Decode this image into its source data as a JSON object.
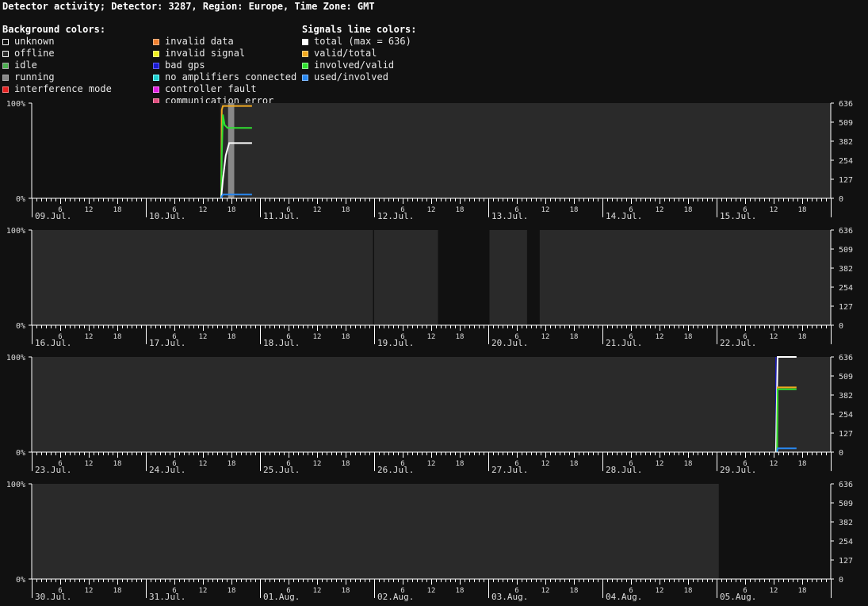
{
  "title": "Detector activity; Detector: 3287, Region: Europe, Time Zone: GMT",
  "legend": {
    "background": {
      "header": "Background colors:",
      "items": [
        {
          "label": "unknown",
          "color": "#111111",
          "border": "#ffffff"
        },
        {
          "label": "offline",
          "color": "#2a2a2a",
          "border": "#ffffff"
        },
        {
          "label": "idle",
          "color": "#4caf50",
          "border": "#aaaaaa"
        },
        {
          "label": "running",
          "color": "#888888",
          "border": "#aaaaaa"
        },
        {
          "label": "interference mode",
          "color": "#e52020",
          "border": "#ff8080"
        }
      ]
    },
    "errors": {
      "items": [
        {
          "label": "invalid data",
          "color": "#f08030",
          "border": "#ffb080"
        },
        {
          "label": "invalid signal",
          "color": "#f0f020",
          "border": "#ffff80"
        },
        {
          "label": "bad gps",
          "color": "#1a1ad0",
          "border": "#6060ff"
        },
        {
          "label": "no amplifiers connected",
          "color": "#20d0d0",
          "border": "#80ffff"
        },
        {
          "label": "controller fault",
          "color": "#e020e0",
          "border": "#ff80ff"
        },
        {
          "label": "communication error",
          "color": "#e05080",
          "border": "#ff90b0"
        }
      ]
    },
    "signals": {
      "header": "Signals line colors:",
      "items": [
        {
          "label": "total (max = 636)",
          "color": "#ffffff",
          "border": "#ffffff"
        },
        {
          "label": "valid/total",
          "color": "#f0a820",
          "border": "#ffd080"
        },
        {
          "label": "involved/valid",
          "color": "#30e030",
          "border": "#90ff90"
        },
        {
          "label": "used/involved",
          "color": "#2888f0",
          "border": "#80b8ff"
        }
      ]
    }
  },
  "chart_data": {
    "type": "area",
    "left_axis": {
      "ticks": [
        "100%",
        "0%"
      ]
    },
    "right_axis": {
      "ticks": [
        "636",
        "509",
        "382",
        "254",
        "127",
        "0"
      ]
    },
    "hour_ticks": [
      "6",
      "12",
      "18"
    ],
    "colors": {
      "unknown": "#111111",
      "offline": "#2a2a2a",
      "running": "#888888",
      "total": "#ffffff",
      "valid_total": "#f0a820",
      "involved_valid": "#30e030",
      "used_involved": "#2888f0",
      "bad_gps": "#1a1ad0"
    },
    "rows": [
      {
        "days": [
          "09.Jul.",
          "10.Jul.",
          "11.Jul.",
          "12.Jul.",
          "13.Jul.",
          "14.Jul.",
          "15.Jul."
        ],
        "background": [
          {
            "state": "unknown",
            "start": 0,
            "end": 1.65
          },
          {
            "state": "offline",
            "start": 1.65,
            "end": 1.72
          },
          {
            "state": "running",
            "start": 1.72,
            "end": 1.775
          },
          {
            "state": "offline",
            "start": 1.775,
            "end": 7
          }
        ],
        "series": [
          {
            "key": "valid_total",
            "points": [
              [
                1.66,
                0
              ],
              [
                1.665,
                0.93
              ],
              [
                1.675,
                0.97
              ],
              [
                1.7,
                0.97
              ],
              [
                1.7,
                0.97
              ],
              [
                1.93,
                0.97
              ]
            ]
          },
          {
            "key": "involved_valid",
            "points": [
              [
                1.66,
                0
              ],
              [
                1.665,
                0.45
              ],
              [
                1.675,
                0.88
              ],
              [
                1.69,
                0.77
              ],
              [
                1.715,
                0.74
              ],
              [
                1.93,
                0.74
              ]
            ]
          },
          {
            "key": "total",
            "points": [
              [
                1.66,
                0
              ],
              [
                1.675,
                0.2
              ],
              [
                1.7,
                0.45
              ],
              [
                1.73,
                0.58
              ],
              [
                1.93,
                0.58
              ]
            ]
          },
          {
            "key": "used_involved",
            "points": [
              [
                1.66,
                0
              ],
              [
                1.665,
                0.02
              ],
              [
                1.675,
                0.04
              ],
              [
                1.93,
                0.04
              ]
            ]
          }
        ]
      },
      {
        "days": [
          "16.Jul.",
          "17.Jul.",
          "18.Jul.",
          "19.Jul.",
          "20.Jul.",
          "21.Jul.",
          "22.Jul."
        ],
        "background": [
          {
            "state": "offline",
            "start": 0,
            "end": 2.99
          },
          {
            "state": "unknown",
            "start": 2.99,
            "end": 3.0
          },
          {
            "state": "offline",
            "start": 3.0,
            "end": 3.56
          },
          {
            "state": "unknown",
            "start": 3.56,
            "end": 4.01
          },
          {
            "state": "offline",
            "start": 4.01,
            "end": 4.34
          },
          {
            "state": "unknown",
            "start": 4.34,
            "end": 4.45
          },
          {
            "state": "offline",
            "start": 4.45,
            "end": 7
          }
        ],
        "series": []
      },
      {
        "days": [
          "23.Jul.",
          "24.Jul.",
          "25.Jul.",
          "26.Jul.",
          "27.Jul.",
          "28.Jul.",
          "29.Jul."
        ],
        "background": [
          {
            "state": "offline",
            "start": 0,
            "end": 6.515
          },
          {
            "state": "bad_gps",
            "start": 6.515,
            "end": 6.525
          },
          {
            "state": "offline",
            "start": 6.525,
            "end": 7
          }
        ],
        "series": [
          {
            "key": "total",
            "points": [
              [
                6.52,
                0
              ],
              [
                6.525,
                0.35
              ],
              [
                6.535,
                1.0
              ],
              [
                6.7,
                1.0
              ]
            ]
          },
          {
            "key": "valid_total",
            "points": [
              [
                6.53,
                0
              ],
              [
                6.535,
                0.68
              ],
              [
                6.7,
                0.68
              ]
            ]
          },
          {
            "key": "involved_valid",
            "points": [
              [
                6.53,
                0
              ],
              [
                6.535,
                0.66
              ],
              [
                6.7,
                0.66
              ]
            ]
          },
          {
            "key": "used_involved",
            "points": [
              [
                6.53,
                0
              ],
              [
                6.535,
                0.04
              ],
              [
                6.7,
                0.04
              ]
            ]
          }
        ]
      },
      {
        "days": [
          "30.Jul.",
          "31.Jul.",
          "01.Aug.",
          "02.Aug.",
          "03.Aug.",
          "04.Aug.",
          "05.Aug."
        ],
        "background": [
          {
            "state": "offline",
            "start": 0,
            "end": 6.02
          },
          {
            "state": "unknown",
            "start": 6.02,
            "end": 7
          }
        ],
        "series": []
      }
    ]
  }
}
